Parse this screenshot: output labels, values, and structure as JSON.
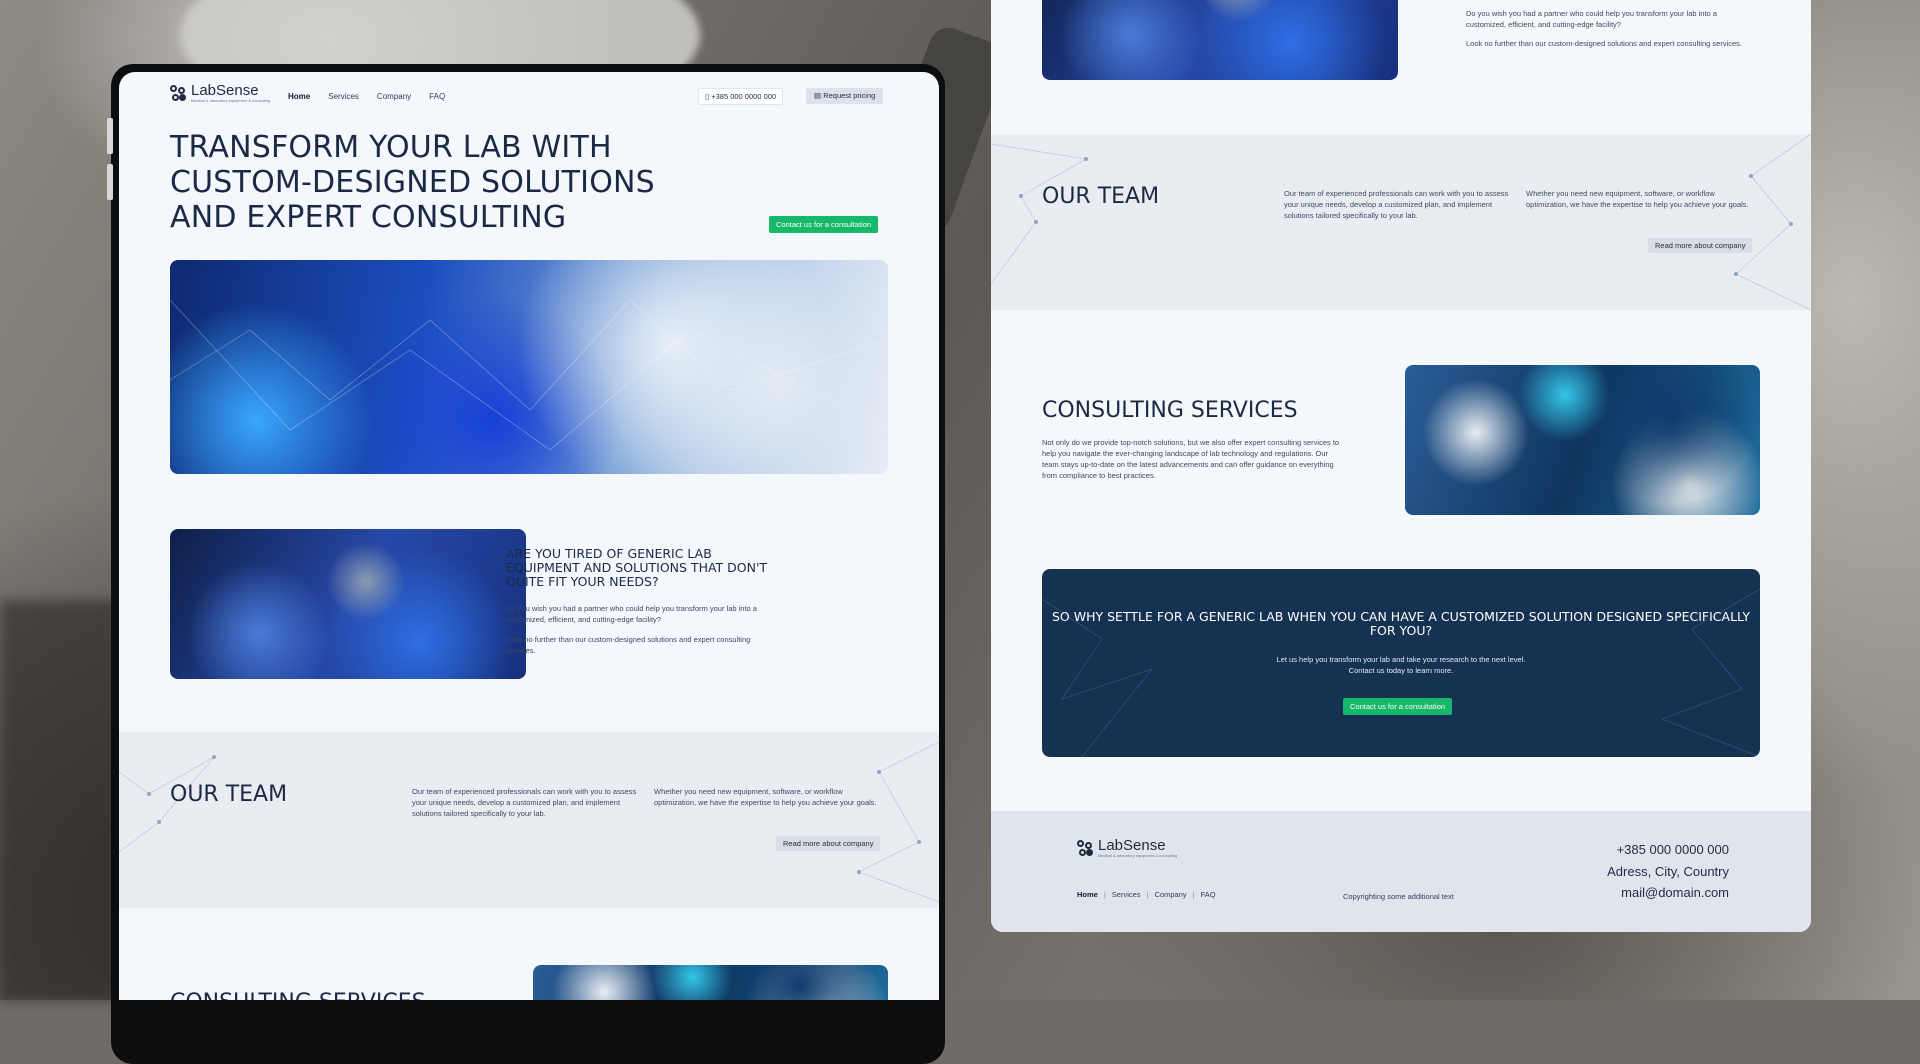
{
  "brand": {
    "name": "LabSense",
    "tagline": "Medical & laboratory equipment & consulting"
  },
  "nav": {
    "links": [
      "Home",
      "Services",
      "Company",
      "FAQ"
    ],
    "phone": "+385 000 0000 000",
    "pricing_label": "Request pricing"
  },
  "hero": {
    "title": "TRANSFORM YOUR LAB WITH CUSTOM-DESIGNED SOLUTIONS AND EXPERT CONSULTING",
    "cta_label": "Contact us for a consultation"
  },
  "generic": {
    "title": "ARE YOU TIRED OF GENERIC LAB EQUIPMENT AND SOLUTIONS THAT DON'T QUITE FIT YOUR NEEDS?",
    "p1": "Do you wish you had a partner who could help you transform your lab into a customized, efficient, and cutting-edge facility?",
    "p2": " Look no further than our custom-designed solutions and expert consulting services."
  },
  "team": {
    "title": "OUR TEAM",
    "p1": "Our team of experienced professionals can work with you to assess your unique needs, develop a customized plan, and implement solutions tailored specifically to your lab.",
    "p2": "Whether you need new equipment, software, or workflow optimization, we have the expertise to help you achieve your goals.",
    "button_label": "Read more about company"
  },
  "consulting": {
    "title": "CONSULTING SERVICES",
    "p": "Not only do we provide top-notch solutions, but we also offer expert consulting services to help you navigate the ever-changing landscape of lab technology and regulations. Our team stays up-to-date on the latest advancements and can offer guidance on everything from compliance to best practices."
  },
  "cta": {
    "title": "SO WHY SETTLE FOR A GENERIC LAB WHEN YOU CAN HAVE A CUSTOMIZED SOLUTION DESIGNED SPECIFICALLY FOR YOU?",
    "line1": "Let us help you transform your lab and take your research to the next level.",
    "line2": "Contact us today to learn more.",
    "button_label": "Contact us for a consultation"
  },
  "footer": {
    "links": [
      "Home",
      "Services",
      "Company",
      "FAQ"
    ],
    "copyright": "Copyrighting some additional text",
    "phone": "+385 000 0000 000",
    "address": "Adress, City, Country",
    "email": "mail@domain.com"
  },
  "colors": {
    "accent_green": "#18b86a",
    "navy": "#163253",
    "text_dark": "#1b2a44"
  },
  "icons": [
    "phone-icon",
    "document-icon",
    "logo-icon"
  ]
}
